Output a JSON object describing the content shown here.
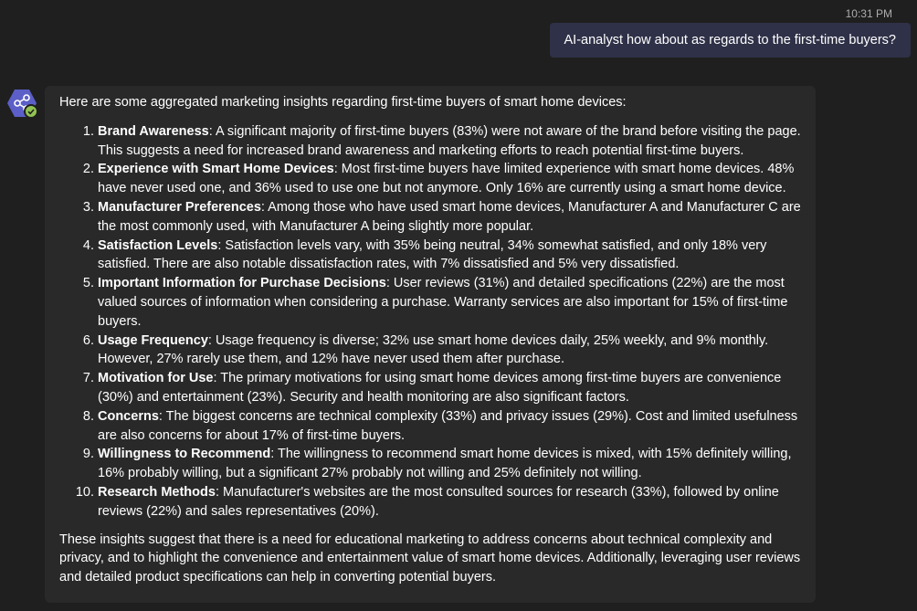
{
  "timestamp": "10:31 PM",
  "user_message": "AI-analyst how about as regards to the first-time buyers?",
  "bot": {
    "avatar_icon": "share-nodes-icon",
    "avatar_color": "#5b5fc7",
    "status_icon": "checkmark-icon",
    "status_color": "#92c353",
    "intro": "Here are some aggregated marketing insights regarding first-time buyers of smart home devices:",
    "items": [
      {
        "title": "Brand Awareness",
        "text": ": A significant majority of first-time buyers (83%) were not aware of the brand before visiting the page. This suggests a need for increased brand awareness and marketing efforts to reach potential first-time buyers."
      },
      {
        "title": "Experience with Smart Home Devices",
        "text": ": Most first-time buyers have limited experience with smart home devices. 48% have never used one, and 36% used to use one but not anymore. Only 16% are currently using a smart home device."
      },
      {
        "title": "Manufacturer Preferences",
        "text": ": Among those who have used smart home devices, Manufacturer A and Manufacturer C are the most commonly used, with Manufacturer A being slightly more popular."
      },
      {
        "title": "Satisfaction Levels",
        "text": ": Satisfaction levels vary, with 35% being neutral, 34% somewhat satisfied, and only 18% very satisfied. There are also notable dissatisfaction rates, with 7% dissatisfied and 5% very dissatisfied."
      },
      {
        "title": "Important Information for Purchase Decisions",
        "text": ": User reviews (31%) and detailed specifications (22%) are the most valued sources of information when considering a purchase. Warranty services are also important for 15% of first-time buyers."
      },
      {
        "title": "Usage Frequency",
        "text": ": Usage frequency is diverse; 32% use smart home devices daily, 25% weekly, and 9% monthly. However, 27% rarely use them, and 12% have never used them after purchase."
      },
      {
        "title": "Motivation for Use",
        "text": ": The primary motivations for using smart home devices among first-time buyers are convenience (30%) and entertainment (23%). Security and health monitoring are also significant factors."
      },
      {
        "title": "Concerns",
        "text": ": The biggest concerns are technical complexity (33%) and privacy issues (29%). Cost and limited usefulness are also concerns for about 17% of first-time buyers."
      },
      {
        "title": "Willingness to Recommend",
        "text": ": The willingness to recommend smart home devices is mixed, with 15% definitely willing, 16% probably willing, but a significant 27% probably not willing and 25% definitely not willing."
      },
      {
        "title": "Research Methods",
        "text": ": Manufacturer's websites are the most consulted sources for research (33%), followed by online reviews (22%) and sales representatives (20%)."
      }
    ],
    "conclusion": "These insights suggest that there is a need for educational marketing to address concerns about technical complexity and privacy, and to highlight the convenience and entertainment value of smart home devices. Additionally, leveraging user reviews and detailed product specifications can help in converting potential buyers."
  }
}
